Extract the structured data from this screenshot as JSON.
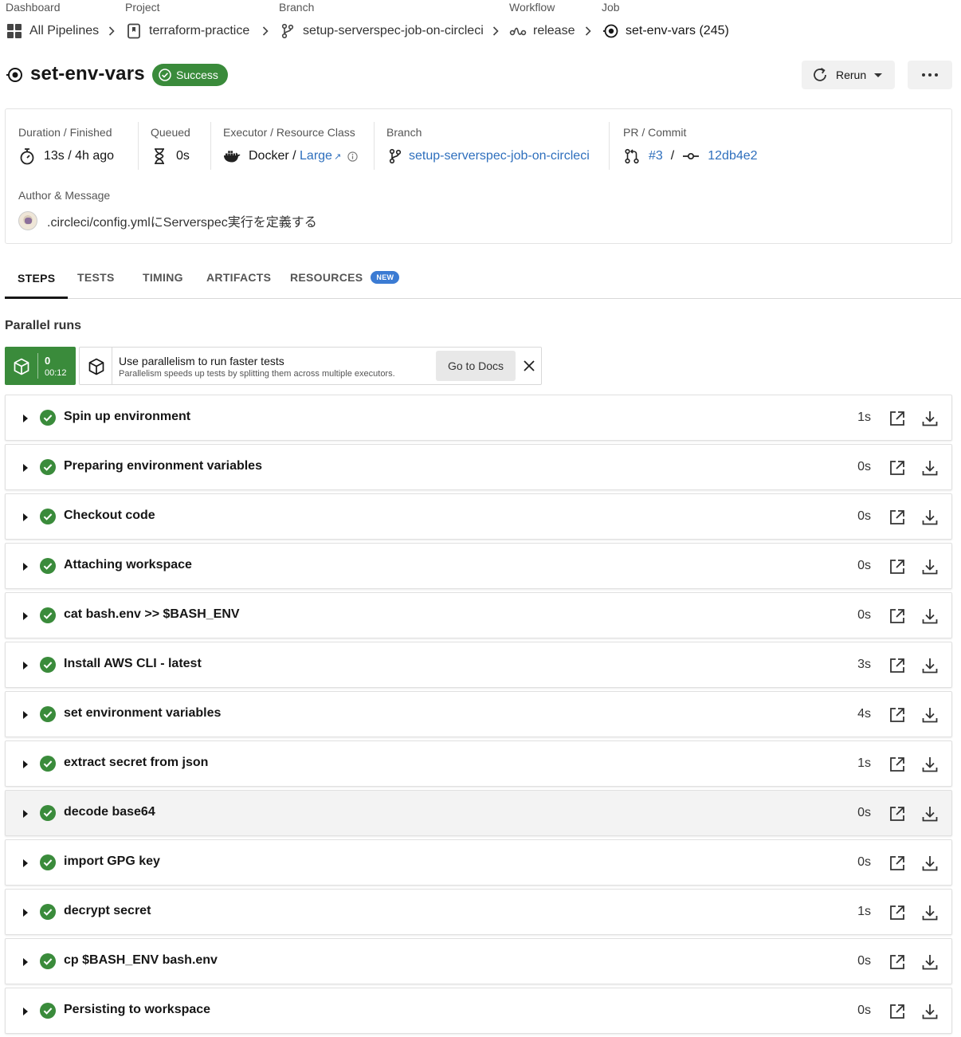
{
  "breadcrumb": {
    "dashboard": {
      "header": "Dashboard",
      "label": "All Pipelines"
    },
    "project": {
      "header": "Project",
      "label": "terraform-practice"
    },
    "branch": {
      "header": "Branch",
      "label": "setup-serverspec-job-on-circleci"
    },
    "workflow": {
      "header": "Workflow",
      "label": "release"
    },
    "job": {
      "header": "Job",
      "label": "set-env-vars (245)"
    }
  },
  "job": {
    "title": "set-env-vars",
    "status": "Success",
    "rerun_label": "Rerun",
    "status_color": "#3a8b3b"
  },
  "info": {
    "duration": {
      "label": "Duration / Finished",
      "value": "13s / 4h ago"
    },
    "queued": {
      "label": "Queued",
      "value": "0s"
    },
    "executor": {
      "label": "Executor / Resource Class",
      "executor": "Docker",
      "sep": " / ",
      "resource_class": "Large"
    },
    "branch": {
      "label": "Branch",
      "value": "setup-serverspec-job-on-circleci"
    },
    "pr_commit": {
      "label": "PR / Commit",
      "pr": "#3",
      "sep": "/",
      "commit": "12db4e2"
    },
    "author": {
      "label": "Author & Message",
      "message": ".circleci/config.ymlにServerspec実行を定義する"
    }
  },
  "tabs": [
    {
      "label": "STEPS",
      "active": true
    },
    {
      "label": "TESTS"
    },
    {
      "label": "TIMING"
    },
    {
      "label": "ARTIFACTS"
    },
    {
      "label": "RESOURCES",
      "badge": "NEW"
    }
  ],
  "parallel": {
    "title": "Parallel runs",
    "run": {
      "index": "0",
      "time": "00:12"
    },
    "promo": {
      "heading": "Use parallelism to run faster tests",
      "subtext": "Parallelism speeds up tests by splitting them across multiple executors.",
      "button": "Go to Docs"
    }
  },
  "steps": [
    {
      "name": "Spin up environment",
      "duration": "1s"
    },
    {
      "name": "Preparing environment variables",
      "duration": "0s"
    },
    {
      "name": "Checkout code",
      "duration": "0s"
    },
    {
      "name": "Attaching workspace",
      "duration": "0s"
    },
    {
      "name": "cat bash.env >> $BASH_ENV",
      "duration": "0s"
    },
    {
      "name": "Install AWS CLI - latest",
      "duration": "3s"
    },
    {
      "name": "set environment variables",
      "duration": "4s"
    },
    {
      "name": "extract secret from json",
      "duration": "1s"
    },
    {
      "name": "decode base64",
      "duration": "0s"
    },
    {
      "name": "import GPG key",
      "duration": "0s"
    },
    {
      "name": "decrypt secret",
      "duration": "1s"
    },
    {
      "name": "cp $BASH_ENV bash.env",
      "duration": "0s"
    },
    {
      "name": "Persisting to workspace",
      "duration": "0s"
    }
  ],
  "colors": {
    "success": "#3a8b3b",
    "link": "#2e6fbd",
    "new_badge": "#3b7bd3"
  }
}
